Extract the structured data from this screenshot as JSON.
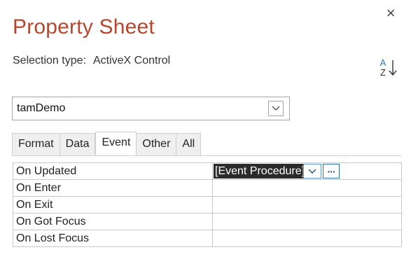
{
  "window": {
    "title": "Property Sheet",
    "close_glyph": "×",
    "close_icon": "close-icon"
  },
  "selection": {
    "label": "Selection type:",
    "value": "ActiveX Control"
  },
  "sort": {
    "icon": "sort-az-icon",
    "top_letter": "A",
    "bottom_letter": "Z"
  },
  "object_combo": {
    "value": "tamDemo",
    "icon": "chevron-down-icon"
  },
  "tabs": [
    {
      "label": "Format",
      "active": false
    },
    {
      "label": "Data",
      "active": false
    },
    {
      "label": "Event",
      "active": true
    },
    {
      "label": "Other",
      "active": false
    },
    {
      "label": "All",
      "active": false
    }
  ],
  "properties": [
    {
      "label": "On Updated",
      "value": "[Event Procedure]"
    },
    {
      "label": "On Enter",
      "value": ""
    },
    {
      "label": "On Exit",
      "value": ""
    },
    {
      "label": "On Got Focus",
      "value": ""
    },
    {
      "label": "On Lost Focus",
      "value": ""
    }
  ],
  "value_buttons": {
    "dropdown_icon": "chevron-down-icon",
    "builder_label": "···",
    "builder_icon": "ellipsis-icon"
  },
  "colors": {
    "title": "#b8472e",
    "selection_highlight": "#2b2b2b",
    "button_border": "#5b9bd5"
  }
}
